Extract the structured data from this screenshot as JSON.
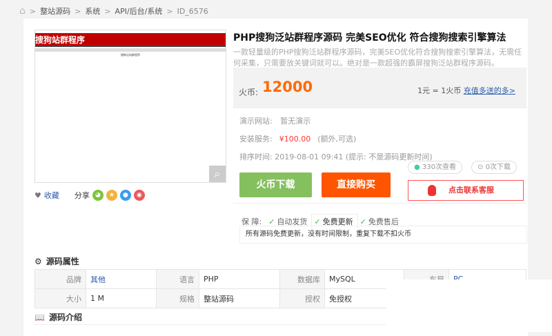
{
  "breadcrumb": [
    "整站源码",
    "系统",
    "API/后台/系统",
    "ID_6576"
  ],
  "preview": {
    "banner": "搜狗站群程序",
    "caption": "搜狗泛站群程序"
  },
  "product": {
    "title": "PHP搜狗泛站群程序源码 完美SEO优化 符合搜狗搜索引擎算法",
    "description": "一款轻量级的PHP搜狗泛站群程序源码，完美SEO优化符合搜狗搜索引擎算法，无需任何采集，只需要放关键词就可以。绝对是一款超强的霸屏搜狗泛站群程序源码。",
    "price_label": "火币:",
    "price": "12000",
    "rate": "1元 = 1火币",
    "recharge_link": "充值多送的多>",
    "demo_label": "演示网站:",
    "demo_value": "暂无演示",
    "install_label": "安装服务:",
    "install_price": "¥100.00",
    "install_note": "(额外,可选)",
    "sort_label": "排序时间:",
    "sort_value": "2019-08-01 09:41",
    "sort_note": "(提示: 不是源码更新时间)",
    "views": "330次查看",
    "downloads": "0次下载"
  },
  "actions": {
    "coin_download": "火币下载",
    "buy_now": "直接购买",
    "contact": "点击联系客服",
    "favorite": "收藏",
    "share": "分享"
  },
  "guarantee": {
    "label": "保  障:",
    "items": [
      "自动发货",
      "免费更新",
      "免费售后"
    ],
    "active_text": "所有源码免费更新，没有时间限制，重复下载不扣火币"
  },
  "attributes": {
    "title": "源码属性",
    "rows": [
      [
        {
          "k": "品牌",
          "v": "其他"
        },
        {
          "k": "语言",
          "v": "PHP"
        },
        {
          "k": "数据库",
          "v": "MySQL"
        },
        {
          "k": "布局",
          "v": "PC"
        }
      ],
      [
        {
          "k": "大小",
          "v": "1 M"
        },
        {
          "k": "规格",
          "v": "整站源码"
        },
        {
          "k": "授权",
          "v": "免授权"
        }
      ]
    ]
  },
  "intro": {
    "title": "源码介绍"
  },
  "colors": {
    "green": "#85c05f",
    "orange": "#ff5500",
    "price": "#ff6a00",
    "red": "#e33333"
  }
}
